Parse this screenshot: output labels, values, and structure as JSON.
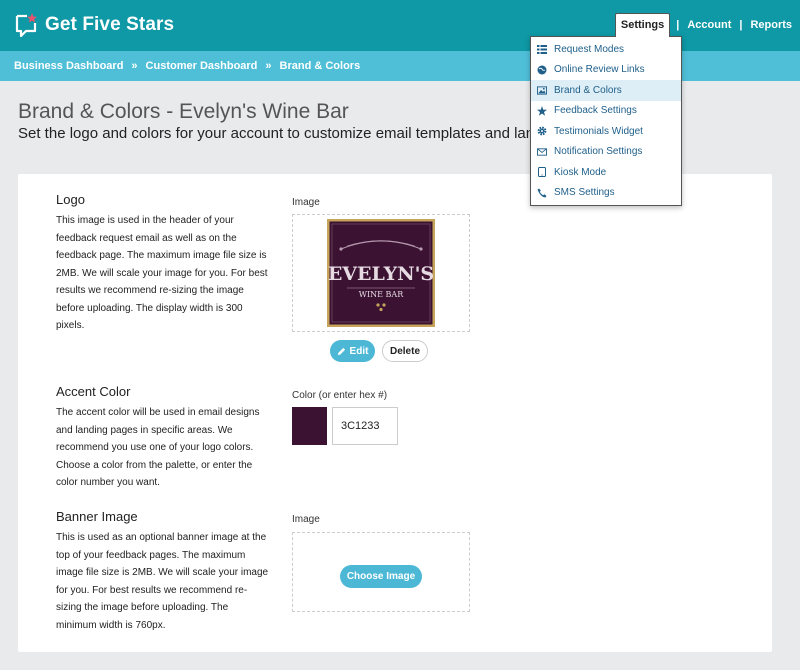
{
  "app": {
    "name": "Get Five Stars"
  },
  "nav": {
    "settings": "Settings",
    "account": "Account",
    "reports": "Reports",
    "separator": "|"
  },
  "breadcrumb": {
    "items": [
      "Business Dashboard",
      "Customer Dashboard",
      "Brand & Colors"
    ],
    "separator": "»"
  },
  "header": {
    "title": "Brand & Colors - Evelyn's Wine Bar",
    "subtitle": "Set the logo and colors for your account to customize email templates and landing pages."
  },
  "settings_menu": {
    "items": [
      {
        "label": "Request Modes",
        "icon": "list-icon"
      },
      {
        "label": "Online Review Links",
        "icon": "globe-icon"
      },
      {
        "label": "Brand & Colors",
        "icon": "image-icon",
        "active": true
      },
      {
        "label": "Feedback Settings",
        "icon": "star-icon"
      },
      {
        "label": "Testimonials Widget",
        "icon": "gear-icon"
      },
      {
        "label": "Notification Settings",
        "icon": "envelope-icon"
      },
      {
        "label": "Kiosk Mode",
        "icon": "tablet-icon"
      },
      {
        "label": "SMS Settings",
        "icon": "phone-icon"
      }
    ]
  },
  "logo_section": {
    "title": "Logo",
    "description": "This image is used in the header of your feedback request email as well as on the feedback page. The maximum image file size is 2MB. We will scale your image for you. For best results we recommend re-sizing the image before uploading. The display width is 300 pixels.",
    "image_label": "Image",
    "logo_text_top": "EVELYN'S",
    "logo_text_bottom": "WINE BAR",
    "edit_label": "Edit",
    "delete_label": "Delete"
  },
  "accent_section": {
    "title": "Accent Color",
    "description": "The accent color will be used in email designs and landing pages in specific areas. We recommend you use one of your logo colors. Choose a color from the palette, or enter the color number you want.",
    "color_label": "Color (or enter hex #)",
    "hex_value": "3C1233"
  },
  "banner_section": {
    "title": "Banner Image",
    "description": "This is used as an optional banner image at the top of your feedback pages. The maximum image file size is 2MB. We will scale your image for you. For best results we recommend re-sizing the image before uploading. The minimum width is 760px.",
    "image_label": "Image",
    "choose_label": "Choose Image"
  },
  "colors": {
    "topbar": "#0f98a5",
    "breadcrumb_bar": "#4fbfd8",
    "button_accent": "#4cb8d6",
    "accent": "#3c1233",
    "logo_gold": "#c6a45a",
    "menu_link": "#1f5f8a"
  }
}
